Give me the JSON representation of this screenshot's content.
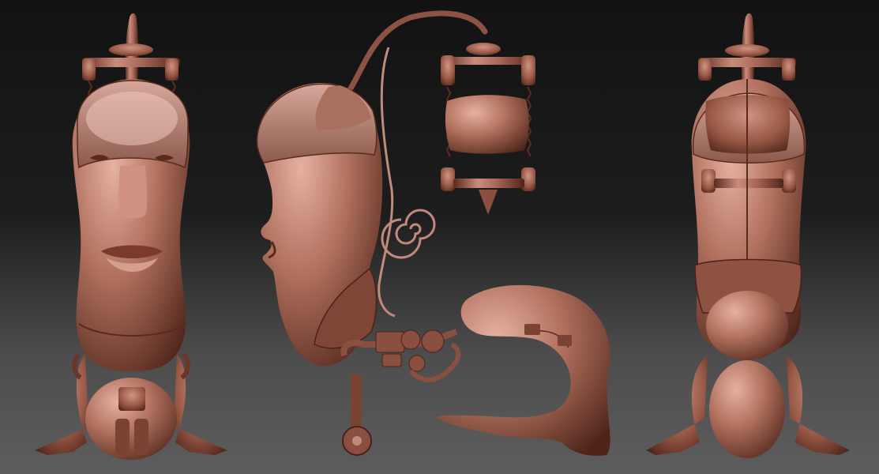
{
  "scene": {
    "colors": {
      "background_top": "#121212",
      "background_bottom": "#5d5d5d",
      "clay_base": "#9c5c48",
      "clay_light": "#e6b1a2",
      "clay_dark": "#4e2419",
      "clay_mid": "#7a4334",
      "cap_tint": "#a86a5a"
    }
  }
}
